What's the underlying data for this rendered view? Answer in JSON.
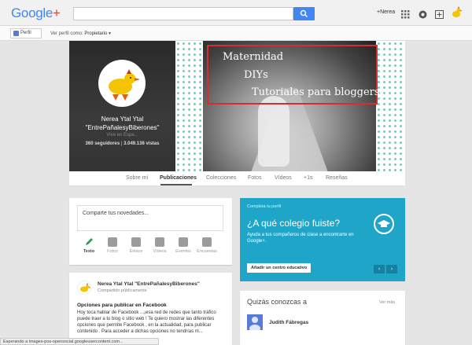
{
  "header": {
    "logo_text": "Google",
    "logo_plus": "+",
    "user_link": "+Nerea"
  },
  "subbar": {
    "profile_button": "Perfil",
    "view_as_label": "Ver perfil como:",
    "view_as_value": "Propietario"
  },
  "profile": {
    "name_line1": "Nerea Ytal Ytal",
    "name_line2": "\"EntrePañalesyBiberones\"",
    "meta": "Vive en Espa...",
    "followers": "360 seguidores",
    "separator": "|",
    "views": "3.049.136 vistas"
  },
  "cover_text": {
    "line1": "Maternidad",
    "line2": "DIYs",
    "line3": "Tutoriales para bloggers"
  },
  "tabs": [
    {
      "label": "Sobre mí"
    },
    {
      "label": "Publicaciones"
    },
    {
      "label": "Colecciones"
    },
    {
      "label": "Fotos"
    },
    {
      "label": "Vídeos"
    },
    {
      "label": "+1s"
    },
    {
      "label": "Reseñas"
    }
  ],
  "compose": {
    "placeholder": "Comparte tus novedades...",
    "buttons": [
      {
        "label": "Texto"
      },
      {
        "label": "Fotos"
      },
      {
        "label": "Enlace"
      },
      {
        "label": "Vídeos"
      },
      {
        "label": "Eventos"
      },
      {
        "label": "Encuestas"
      }
    ]
  },
  "post": {
    "author": "Nerea Ytal Ytal \"EntrePañalesyBiberones\"",
    "subtitle": "Compartido públicamente",
    "title": "Opciones para publicar en Facebook",
    "body": "Hoy toca hablar de Facebook ...¡esa red de redes que tanto tráfico puede traer a tu blog o sitio web ! Te quiero mostrar las diferentes opciones que permite Facebook , en la actualidad, para publicar contenido . Para acceder a dichas opciones no tendrías m..."
  },
  "complete_card": {
    "small": "Completa tu perfil",
    "title": "¿A qué colegio fuiste?",
    "description": "Ayuda a tus compañeros de clase a encontrarte en Google+.",
    "button": "Añadir un centro educativo",
    "prev": "‹",
    "next": "›"
  },
  "suggestions": {
    "title": "Quizás conozcas a",
    "more": "Ver más",
    "person": "Judith Fábregas"
  },
  "status_bar": "Esperando a images-pos-opensocial.googleusercontent.com...",
  "colors": {
    "accent_blue": "#4285f4",
    "card_blue": "#1fa5c8",
    "red_frame": "#d32f2f",
    "dots_teal": "#79c9b6"
  }
}
